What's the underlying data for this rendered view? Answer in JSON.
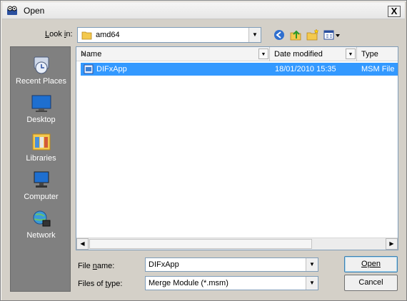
{
  "window": {
    "title": "Open",
    "close_label": "X"
  },
  "lookin": {
    "label": "Look in:",
    "folder": "amd64"
  },
  "places": [
    {
      "label": "Recent Places",
      "icon": "recent-places-icon"
    },
    {
      "label": "Desktop",
      "icon": "desktop-icon"
    },
    {
      "label": "Libraries",
      "icon": "libraries-icon"
    },
    {
      "label": "Computer",
      "icon": "computer-icon"
    },
    {
      "label": "Network",
      "icon": "network-icon"
    }
  ],
  "columns": {
    "name": "Name",
    "date": "Date modified",
    "type": "Type"
  },
  "files": [
    {
      "name": "DIFxApp",
      "date": "18/01/2010 15:35",
      "type": "MSM File",
      "selected": true
    }
  ],
  "filename": {
    "label": "File name:",
    "value": "DIFxApp"
  },
  "filetype": {
    "label": "Files of type:",
    "value": "Merge Module (*.msm)"
  },
  "buttons": {
    "open": "Open",
    "cancel": "Cancel"
  },
  "colors": {
    "selection": "#3399ff",
    "places_bg": "#808080",
    "dialog_bg": "#d4d0c8"
  }
}
